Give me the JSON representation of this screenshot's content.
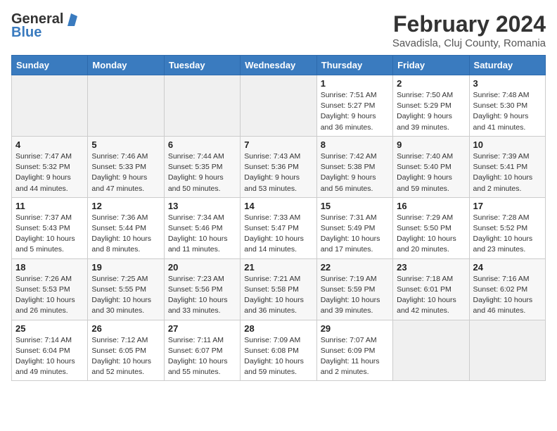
{
  "logo": {
    "general": "General",
    "blue": "Blue"
  },
  "header": {
    "month": "February 2024",
    "location": "Savadisla, Cluj County, Romania"
  },
  "days_of_week": [
    "Sunday",
    "Monday",
    "Tuesday",
    "Wednesday",
    "Thursday",
    "Friday",
    "Saturday"
  ],
  "weeks": [
    [
      {
        "day": "",
        "info": ""
      },
      {
        "day": "",
        "info": ""
      },
      {
        "day": "",
        "info": ""
      },
      {
        "day": "",
        "info": ""
      },
      {
        "day": "1",
        "info": "Sunrise: 7:51 AM\nSunset: 5:27 PM\nDaylight: 9 hours\nand 36 minutes."
      },
      {
        "day": "2",
        "info": "Sunrise: 7:50 AM\nSunset: 5:29 PM\nDaylight: 9 hours\nand 39 minutes."
      },
      {
        "day": "3",
        "info": "Sunrise: 7:48 AM\nSunset: 5:30 PM\nDaylight: 9 hours\nand 41 minutes."
      }
    ],
    [
      {
        "day": "4",
        "info": "Sunrise: 7:47 AM\nSunset: 5:32 PM\nDaylight: 9 hours\nand 44 minutes."
      },
      {
        "day": "5",
        "info": "Sunrise: 7:46 AM\nSunset: 5:33 PM\nDaylight: 9 hours\nand 47 minutes."
      },
      {
        "day": "6",
        "info": "Sunrise: 7:44 AM\nSunset: 5:35 PM\nDaylight: 9 hours\nand 50 minutes."
      },
      {
        "day": "7",
        "info": "Sunrise: 7:43 AM\nSunset: 5:36 PM\nDaylight: 9 hours\nand 53 minutes."
      },
      {
        "day": "8",
        "info": "Sunrise: 7:42 AM\nSunset: 5:38 PM\nDaylight: 9 hours\nand 56 minutes."
      },
      {
        "day": "9",
        "info": "Sunrise: 7:40 AM\nSunset: 5:40 PM\nDaylight: 9 hours\nand 59 minutes."
      },
      {
        "day": "10",
        "info": "Sunrise: 7:39 AM\nSunset: 5:41 PM\nDaylight: 10 hours\nand 2 minutes."
      }
    ],
    [
      {
        "day": "11",
        "info": "Sunrise: 7:37 AM\nSunset: 5:43 PM\nDaylight: 10 hours\nand 5 minutes."
      },
      {
        "day": "12",
        "info": "Sunrise: 7:36 AM\nSunset: 5:44 PM\nDaylight: 10 hours\nand 8 minutes."
      },
      {
        "day": "13",
        "info": "Sunrise: 7:34 AM\nSunset: 5:46 PM\nDaylight: 10 hours\nand 11 minutes."
      },
      {
        "day": "14",
        "info": "Sunrise: 7:33 AM\nSunset: 5:47 PM\nDaylight: 10 hours\nand 14 minutes."
      },
      {
        "day": "15",
        "info": "Sunrise: 7:31 AM\nSunset: 5:49 PM\nDaylight: 10 hours\nand 17 minutes."
      },
      {
        "day": "16",
        "info": "Sunrise: 7:29 AM\nSunset: 5:50 PM\nDaylight: 10 hours\nand 20 minutes."
      },
      {
        "day": "17",
        "info": "Sunrise: 7:28 AM\nSunset: 5:52 PM\nDaylight: 10 hours\nand 23 minutes."
      }
    ],
    [
      {
        "day": "18",
        "info": "Sunrise: 7:26 AM\nSunset: 5:53 PM\nDaylight: 10 hours\nand 26 minutes."
      },
      {
        "day": "19",
        "info": "Sunrise: 7:25 AM\nSunset: 5:55 PM\nDaylight: 10 hours\nand 30 minutes."
      },
      {
        "day": "20",
        "info": "Sunrise: 7:23 AM\nSunset: 5:56 PM\nDaylight: 10 hours\nand 33 minutes."
      },
      {
        "day": "21",
        "info": "Sunrise: 7:21 AM\nSunset: 5:58 PM\nDaylight: 10 hours\nand 36 minutes."
      },
      {
        "day": "22",
        "info": "Sunrise: 7:19 AM\nSunset: 5:59 PM\nDaylight: 10 hours\nand 39 minutes."
      },
      {
        "day": "23",
        "info": "Sunrise: 7:18 AM\nSunset: 6:01 PM\nDaylight: 10 hours\nand 42 minutes."
      },
      {
        "day": "24",
        "info": "Sunrise: 7:16 AM\nSunset: 6:02 PM\nDaylight: 10 hours\nand 46 minutes."
      }
    ],
    [
      {
        "day": "25",
        "info": "Sunrise: 7:14 AM\nSunset: 6:04 PM\nDaylight: 10 hours\nand 49 minutes."
      },
      {
        "day": "26",
        "info": "Sunrise: 7:12 AM\nSunset: 6:05 PM\nDaylight: 10 hours\nand 52 minutes."
      },
      {
        "day": "27",
        "info": "Sunrise: 7:11 AM\nSunset: 6:07 PM\nDaylight: 10 hours\nand 55 minutes."
      },
      {
        "day": "28",
        "info": "Sunrise: 7:09 AM\nSunset: 6:08 PM\nDaylight: 10 hours\nand 59 minutes."
      },
      {
        "day": "29",
        "info": "Sunrise: 7:07 AM\nSunset: 6:09 PM\nDaylight: 11 hours\nand 2 minutes."
      },
      {
        "day": "",
        "info": ""
      },
      {
        "day": "",
        "info": ""
      }
    ]
  ]
}
